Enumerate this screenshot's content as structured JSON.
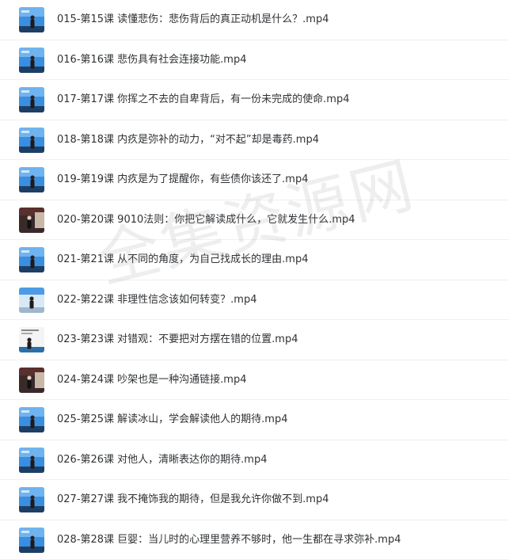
{
  "files": [
    {
      "name": "015-第15课 读懂悲伤：悲伤背后的真正动机是什么？.mp4",
      "thumb": "blue-stage"
    },
    {
      "name": "016-第16课 悲伤具有社会连接功能.mp4",
      "thumb": "blue-stage"
    },
    {
      "name": "017-第17课 你挥之不去的自卑背后，有一份未完成的使命.mp4",
      "thumb": "blue-stage"
    },
    {
      "name": "018-第18课 内疚是弥补的动力，“对不起”却是毒药.mp4",
      "thumb": "blue-stage"
    },
    {
      "name": "019-第19课 内疚是为了提醒你，有些债你该还了.mp4",
      "thumb": "blue-stage"
    },
    {
      "name": "020-第20课 9010法则：你把它解读成什么，它就发生什么.mp4",
      "thumb": "dark-room"
    },
    {
      "name": "021-第21课 从不同的角度，为自己找成长的理由.mp4",
      "thumb": "blue-stage"
    },
    {
      "name": "022-第22课 非理性信念该如何转变？.mp4",
      "thumb": "light-room"
    },
    {
      "name": "023-第23课 对错观：不要把对方摆在错的位置.mp4",
      "thumb": "white-slide"
    },
    {
      "name": "024-第24课 吵架也是一种沟通链接.mp4",
      "thumb": "dark-room"
    },
    {
      "name": "025-第25课 解读冰山，学会解读他人的期待.mp4",
      "thumb": "blue-stage"
    },
    {
      "name": "026-第26课 对他人，清晰表达你的期待.mp4",
      "thumb": "blue-stage"
    },
    {
      "name": "027-第27课 我不掩饰我的期待，但是我允许你做不到.mp4",
      "thumb": "blue-stage"
    },
    {
      "name": "028-第28课 巨婴：当儿时的心理里营养不够时，他一生都在寻求弥补.mp4",
      "thumb": "blue-stage"
    }
  ],
  "icons": {
    "blue-stage": "video-thumbnail-icon",
    "dark-room": "video-thumbnail-icon",
    "light-room": "video-thumbnail-icon",
    "white-slide": "video-thumbnail-icon"
  },
  "colors": {
    "text": "#2f3235",
    "divider": "#f0f0f2",
    "stage_blue": "#3b8fe0",
    "dark_bg": "#3a2a2a"
  },
  "watermark": "全集资源网"
}
